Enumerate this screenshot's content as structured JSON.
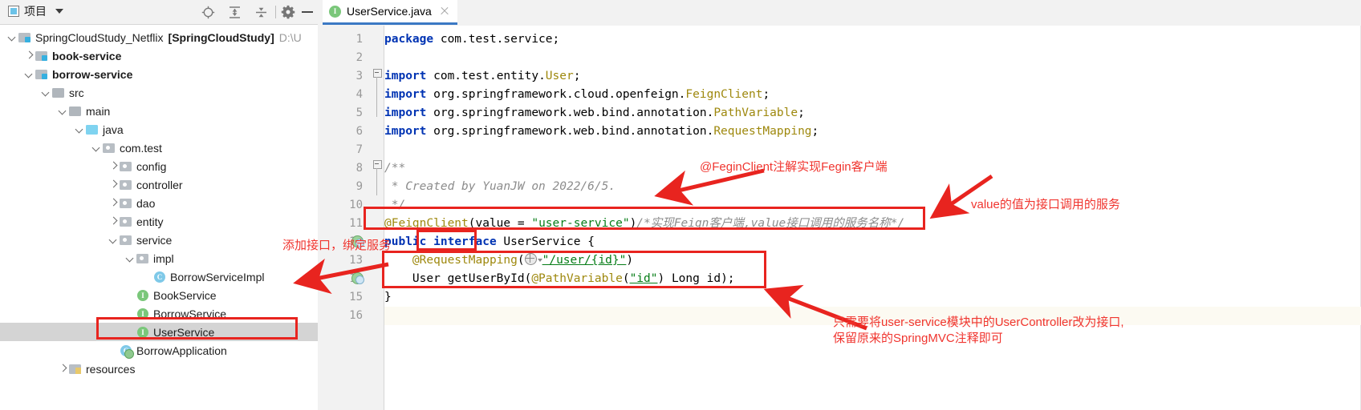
{
  "sidebar": {
    "toolbar": {
      "title": "项目",
      "icons": [
        "locate-icon",
        "expand-all-icon",
        "collapse-all-icon",
        "gear-icon",
        "minimize-icon"
      ]
    },
    "tree": [
      {
        "label": "SpringCloudStudy_Netflix",
        "bold_suffix": "[SpringCloudStudy]",
        "path": "D:\\U",
        "icon": "module-folder-icon",
        "arrow": "down",
        "indent": 0,
        "style": "plain"
      },
      {
        "label": "book-service",
        "icon": "module-folder-icon",
        "arrow": "right",
        "indent": 1,
        "style": "bold"
      },
      {
        "label": "borrow-service",
        "icon": "module-folder-icon",
        "arrow": "down",
        "indent": 1,
        "style": "bold"
      },
      {
        "label": "src",
        "icon": "folder-icon",
        "arrow": "down",
        "indent": 2,
        "style": "plain"
      },
      {
        "label": "main",
        "icon": "folder-icon",
        "arrow": "down",
        "indent": 3,
        "style": "plain"
      },
      {
        "label": "java",
        "icon": "source-folder-icon",
        "arrow": "down",
        "indent": 4,
        "style": "plain"
      },
      {
        "label": "com.test",
        "icon": "package-icon",
        "arrow": "down",
        "indent": 5,
        "style": "plain"
      },
      {
        "label": "config",
        "icon": "package-icon",
        "arrow": "right",
        "indent": 6,
        "style": "plain"
      },
      {
        "label": "controller",
        "icon": "package-icon",
        "arrow": "right",
        "indent": 6,
        "style": "plain"
      },
      {
        "label": "dao",
        "icon": "package-icon",
        "arrow": "right",
        "indent": 6,
        "style": "plain"
      },
      {
        "label": "entity",
        "icon": "package-icon",
        "arrow": "right",
        "indent": 6,
        "style": "plain"
      },
      {
        "label": "service",
        "icon": "package-icon",
        "arrow": "down",
        "indent": 6,
        "style": "plain"
      },
      {
        "label": "impl",
        "icon": "package-icon",
        "arrow": "down",
        "indent": 7,
        "style": "plain"
      },
      {
        "label": "BorrowServiceImpl",
        "icon": "class-icon",
        "arrow": "none",
        "indent": 8,
        "style": "plain"
      },
      {
        "label": "BookService",
        "icon": "interface-icon",
        "arrow": "none",
        "indent": 7,
        "style": "plain"
      },
      {
        "label": "BorrowService",
        "icon": "interface-icon",
        "arrow": "none",
        "indent": 7,
        "style": "underline"
      },
      {
        "label": "UserService",
        "icon": "interface-icon",
        "arrow": "none",
        "indent": 7,
        "style": "selected"
      },
      {
        "label": "BorrowApplication",
        "icon": "runnable-class-icon",
        "arrow": "none",
        "indent": 6,
        "style": "plain"
      },
      {
        "label": "resources",
        "icon": "resources-folder-icon",
        "arrow": "right",
        "indent": 3,
        "style": "plain"
      }
    ]
  },
  "editor": {
    "tab": {
      "label": "UserService.java",
      "icon": "interface-icon",
      "close": "close-icon"
    },
    "line_numbers": [
      "1",
      "2",
      "3",
      "4",
      "5",
      "6",
      "7",
      "8",
      "9",
      "10",
      "11",
      "12",
      "13",
      "14",
      "15",
      "16"
    ],
    "code": [
      {
        "n": 1,
        "tokens": [
          {
            "t": "package",
            "c": "k"
          },
          {
            "t": " com.test.service;",
            "c": "id"
          }
        ]
      },
      {
        "n": 2,
        "tokens": []
      },
      {
        "n": 3,
        "tokens": [
          {
            "t": "import",
            "c": "k"
          },
          {
            "t": " com.test.entity.",
            "c": "id"
          },
          {
            "t": "User",
            "c": "ann"
          },
          {
            "t": ";",
            "c": "id"
          }
        ]
      },
      {
        "n": 4,
        "tokens": [
          {
            "t": "import",
            "c": "k"
          },
          {
            "t": " org.springframework.cloud.openfeign.",
            "c": "id"
          },
          {
            "t": "FeignClient",
            "c": "ann"
          },
          {
            "t": ";",
            "c": "id"
          }
        ]
      },
      {
        "n": 5,
        "tokens": [
          {
            "t": "import",
            "c": "k"
          },
          {
            "t": " org.springframework.web.bind.annotation.",
            "c": "id"
          },
          {
            "t": "PathVariable",
            "c": "ann"
          },
          {
            "t": ";",
            "c": "id"
          }
        ]
      },
      {
        "n": 6,
        "tokens": [
          {
            "t": "import",
            "c": "k"
          },
          {
            "t": " org.springframework.web.bind.annotation.",
            "c": "id"
          },
          {
            "t": "RequestMapping",
            "c": "ann"
          },
          {
            "t": ";",
            "c": "id"
          }
        ]
      },
      {
        "n": 7,
        "tokens": []
      },
      {
        "n": 8,
        "tokens": [
          {
            "t": "/**",
            "c": "cmt"
          }
        ]
      },
      {
        "n": 9,
        "tokens": [
          {
            "t": " * Created by YuanJW on 2022/6/5.",
            "c": "cmt"
          }
        ]
      },
      {
        "n": 10,
        "tokens": [
          {
            "t": " */",
            "c": "cmt"
          }
        ]
      },
      {
        "n": 11,
        "tokens": [
          {
            "t": "@FeignClient",
            "c": "ann"
          },
          {
            "t": "(value = ",
            "c": "id"
          },
          {
            "t": "\"user-service\"",
            "c": "str"
          },
          {
            "t": ")",
            "c": "id"
          },
          {
            "t": "/*实现Feign客户端,value接口调用的服务名称*/",
            "c": "cmt"
          }
        ]
      },
      {
        "n": 12,
        "tokens": [
          {
            "t": "public",
            "c": "k"
          },
          {
            "t": " ",
            "c": "id"
          },
          {
            "t": "interface",
            "c": "k"
          },
          {
            "t": " UserService {",
            "c": "id"
          }
        ]
      },
      {
        "n": 13,
        "tokens": [
          {
            "t": "    ",
            "c": "id"
          },
          {
            "t": "@RequestMapping",
            "c": "ann"
          },
          {
            "t": "(",
            "c": "id"
          },
          {
            "t": "GLOBE",
            "c": "globe"
          },
          {
            "t": "\"/user/{id}\"",
            "c": "str-ul"
          },
          {
            "t": ")",
            "c": "id"
          }
        ]
      },
      {
        "n": 14,
        "tokens": [
          {
            "t": "    User getUserById(",
            "c": "id"
          },
          {
            "t": "@PathVariable",
            "c": "ann"
          },
          {
            "t": "(",
            "c": "id"
          },
          {
            "t": "\"id\"",
            "c": "str-ul"
          },
          {
            "t": ") ",
            "c": "id"
          },
          {
            "t": "Long",
            "c": "id"
          },
          {
            "t": " id);",
            "c": "id"
          }
        ]
      },
      {
        "n": 15,
        "tokens": [
          {
            "t": "}",
            "c": "id"
          }
        ]
      },
      {
        "n": 16,
        "tokens": []
      }
    ]
  },
  "annotations": {
    "color": "#f0352f",
    "notes": [
      {
        "id": "note-fegin-client",
        "text": "@FeginClient注解实现Fegin客户端"
      },
      {
        "id": "note-value",
        "text": "value的值为接口调用的服务"
      },
      {
        "id": "note-add-interface",
        "text": "添加接口，绑定服务"
      },
      {
        "id": "note-usercontroller-line1",
        "text": "只需要将user-service模块中的UserController改为接口,"
      },
      {
        "id": "note-usercontroller-line2",
        "text": "保留原来的SpringMVC注释即可"
      }
    ],
    "boxes": [
      {
        "id": "box-feign-annotation"
      },
      {
        "id": "box-interface-keyword"
      },
      {
        "id": "box-request-mapping-method"
      },
      {
        "id": "box-userservice-tree-item"
      }
    ]
  }
}
